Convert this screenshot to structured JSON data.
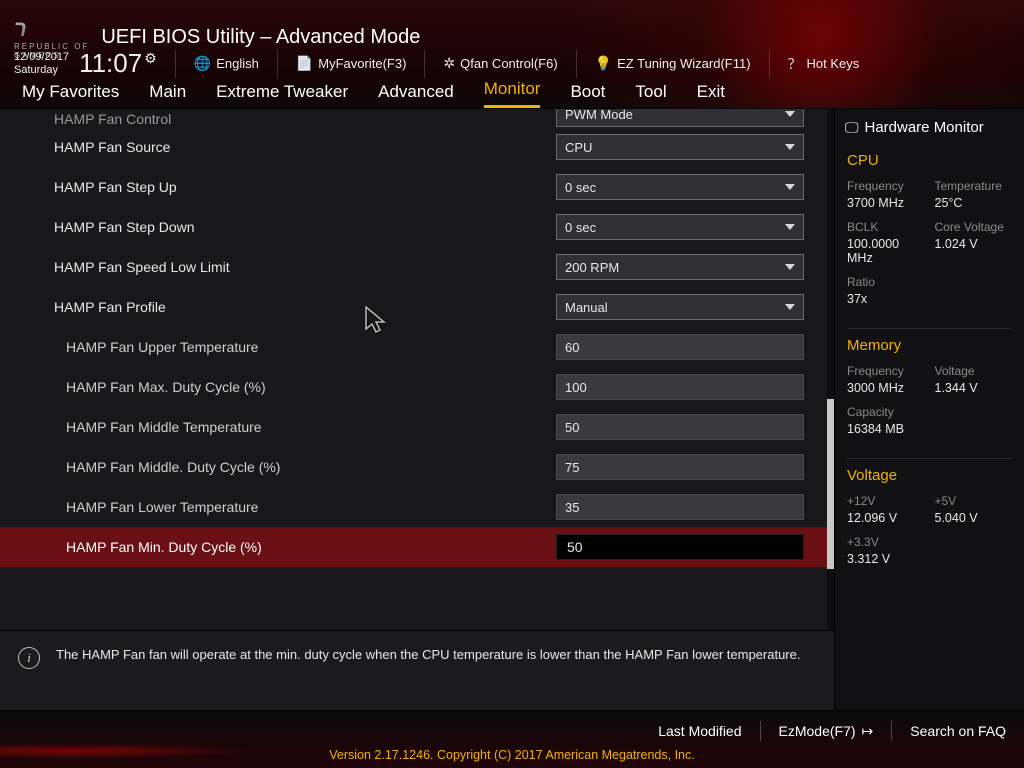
{
  "header": {
    "title": "UEFI BIOS Utility – Advanced Mode",
    "date": "12/09/2017",
    "day": "Saturday",
    "time": "11:07",
    "toolbar": {
      "language": "English",
      "favorite": "MyFavorite(F3)",
      "qfan": "Qfan Control(F6)",
      "eztune": "EZ Tuning Wizard(F11)",
      "hotkeys": "Hot Keys"
    }
  },
  "tabs": [
    "My Favorites",
    "Main",
    "Extreme Tweaker",
    "Advanced",
    "Monitor",
    "Boot",
    "Tool",
    "Exit"
  ],
  "active_tab": "Monitor",
  "rows": [
    {
      "kind": "dd",
      "indent": 0,
      "cut": true,
      "label": "HAMP Fan Control",
      "value": "PWM Mode"
    },
    {
      "kind": "dd",
      "indent": 0,
      "label": "HAMP Fan Source",
      "value": "CPU"
    },
    {
      "kind": "dd",
      "indent": 0,
      "label": "HAMP Fan Step Up",
      "value": "0 sec"
    },
    {
      "kind": "dd",
      "indent": 0,
      "label": "HAMP Fan Step Down",
      "value": "0 sec"
    },
    {
      "kind": "dd",
      "indent": 0,
      "label": "HAMP Fan Speed Low Limit",
      "value": "200 RPM"
    },
    {
      "kind": "dd",
      "indent": 0,
      "label": "HAMP Fan Profile",
      "value": "Manual"
    },
    {
      "kind": "txt",
      "indent": 1,
      "label": "HAMP Fan Upper Temperature",
      "value": "60"
    },
    {
      "kind": "txt",
      "indent": 1,
      "label": "HAMP Fan Max. Duty Cycle (%)",
      "value": "100"
    },
    {
      "kind": "txt",
      "indent": 1,
      "label": "HAMP Fan Middle Temperature",
      "value": "50"
    },
    {
      "kind": "txt",
      "indent": 1,
      "label": "HAMP Fan Middle. Duty Cycle (%)",
      "value": "75"
    },
    {
      "kind": "txt",
      "indent": 1,
      "label": "HAMP Fan Lower Temperature",
      "value": "35"
    },
    {
      "kind": "txt",
      "indent": 1,
      "selected": true,
      "label": "HAMP Fan Min. Duty Cycle (%)",
      "value": "50"
    }
  ],
  "help_text": "The HAMP Fan fan will operate at the min. duty cycle when the CPU temperature is lower than the HAMP Fan lower temperature.",
  "hw": {
    "title": "Hardware Monitor",
    "cpu": {
      "title": "CPU",
      "freq_k": "Frequency",
      "freq_v": "3700 MHz",
      "temp_k": "Temperature",
      "temp_v": "25°C",
      "bclk_k": "BCLK",
      "bclk_v": "100.0000 MHz",
      "cv_k": "Core Voltage",
      "cv_v": "1.024 V",
      "ratio_k": "Ratio",
      "ratio_v": "37x"
    },
    "mem": {
      "title": "Memory",
      "freq_k": "Frequency",
      "freq_v": "3000 MHz",
      "volt_k": "Voltage",
      "volt_v": "1.344 V",
      "cap_k": "Capacity",
      "cap_v": "16384 MB"
    },
    "volt": {
      "title": "Voltage",
      "p12_k": "+12V",
      "p12_v": "12.096 V",
      "p5_k": "+5V",
      "p5_v": "5.040 V",
      "p33_k": "+3.3V",
      "p33_v": "3.312 V"
    }
  },
  "footer": {
    "last_modified": "Last Modified",
    "ezmode": "EzMode(F7)",
    "search": "Search on FAQ",
    "version": "Version 2.17.1246. Copyright (C) 2017 American Megatrends, Inc."
  }
}
